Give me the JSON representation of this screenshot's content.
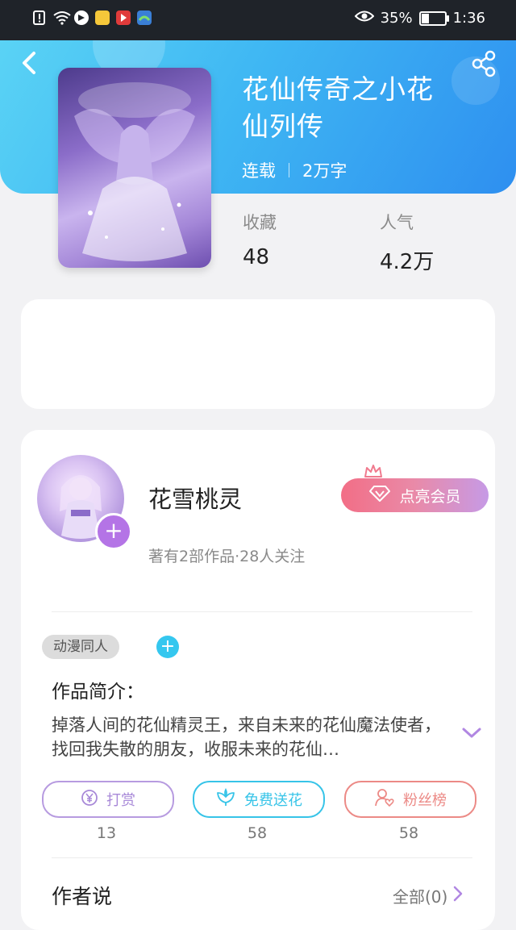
{
  "status_bar": {
    "battery": "35%",
    "time": "1:36",
    "icons": [
      "sim-alert-icon",
      "wifi-icon",
      "app-notify-icon-1",
      "app-notify-icon-2",
      "app-notify-icon-3",
      "app-notify-icon-4",
      "eye-icon",
      "battery-icon"
    ]
  },
  "book": {
    "title_line1": "花仙传奇之小花",
    "title_line2": "仙列传",
    "status": "连载",
    "words": "2万字",
    "stats": [
      {
        "label": "收藏",
        "value": "48"
      },
      {
        "label": "人气",
        "value": "4.2万"
      }
    ]
  },
  "author": {
    "name": "花雪桃灵",
    "subtitle": "著有2部作品·28人关注",
    "vip_label": "点亮会员"
  },
  "tag": "动漫同人",
  "intro": {
    "title": "作品简介：",
    "text": "掉落人间的花仙精灵王，来自未来的花仙魔法使者，找回我失散的朋友，收服未来的花仙…"
  },
  "actions": [
    {
      "label": "打赏",
      "count": "13",
      "color": "#a889d8"
    },
    {
      "label": "免费送花",
      "count": "58",
      "color": "#37c4e8"
    },
    {
      "label": "粉丝榜",
      "count": "58",
      "color": "#ec8a86"
    }
  ],
  "author_says": {
    "title": "作者说",
    "all_label": "全部(0)"
  },
  "colors": {
    "header_start": "#5ad3f5",
    "header_end": "#2e8ff0",
    "vip_start": "#f26e86",
    "vip_end": "#c69ae6"
  }
}
